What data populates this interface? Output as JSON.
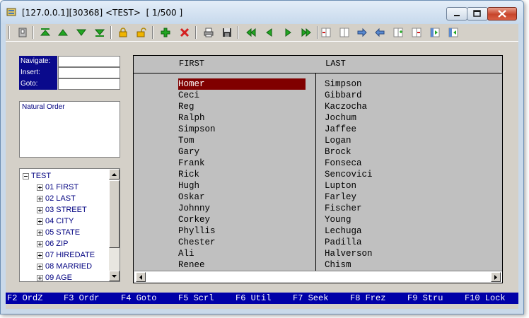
{
  "window": {
    "title": "[127.0.0.1][30368] <TEST>  [ 1/500 ]"
  },
  "toolbar": {
    "buttons": [
      {
        "icon": "disk-drive-icon"
      },
      {
        "icon": "go-top-icon"
      },
      {
        "icon": "go-up-icon"
      },
      {
        "icon": "go-down-icon"
      },
      {
        "icon": "go-bottom-icon"
      },
      {
        "icon": "lock-icon"
      },
      {
        "icon": "unlock-icon"
      },
      {
        "icon": "add-icon"
      },
      {
        "icon": "delete-icon"
      },
      {
        "icon": "print-icon"
      },
      {
        "icon": "save-icon"
      },
      {
        "icon": "first-record-icon"
      },
      {
        "icon": "prev-record-icon"
      },
      {
        "icon": "next-record-icon"
      },
      {
        "icon": "last-record-icon"
      },
      {
        "icon": "delete-column-icon"
      },
      {
        "icon": "column-icon"
      },
      {
        "icon": "move-right-icon"
      },
      {
        "icon": "move-left-icon"
      },
      {
        "icon": "insert-column-icon"
      },
      {
        "icon": "remove-column-icon"
      },
      {
        "icon": "freeze-left-icon"
      },
      {
        "icon": "freeze-right-icon"
      }
    ]
  },
  "nav": {
    "navigate_label": "Navigate:",
    "insert_label": "Insert:",
    "goto_label": "Goto:"
  },
  "order": {
    "text": "Natural Order"
  },
  "tree": {
    "root": "TEST",
    "items": [
      "01 FIRST",
      "02 LAST",
      "03 STREET",
      "04 CITY",
      "05 STATE",
      "06 ZIP",
      "07 HIREDATE",
      "08 MARRIED",
      "09 AGE"
    ]
  },
  "grid": {
    "columns": [
      "FIRST",
      "LAST"
    ],
    "rows": [
      [
        "Homer",
        "Simpson"
      ],
      [
        "Ceci",
        "Gibbard"
      ],
      [
        "Reg",
        "Kaczocha"
      ],
      [
        "Ralph",
        "Jochum"
      ],
      [
        "Simpson",
        "Jaffee"
      ],
      [
        "Tom",
        "Logan"
      ],
      [
        "Gary",
        "Brock"
      ],
      [
        "Frank",
        "Fonseca"
      ],
      [
        "Rick",
        "Sencovici"
      ],
      [
        "Hugh",
        "Lupton"
      ],
      [
        "Oskar",
        "Farley"
      ],
      [
        "Johnny",
        "Fischer"
      ],
      [
        "Corkey",
        "Young"
      ],
      [
        "Phyllis",
        "Lechuga"
      ],
      [
        "Chester",
        "Padilla"
      ],
      [
        "Ali",
        "Halverson"
      ],
      [
        "Renee",
        "Chism"
      ]
    ],
    "selected_row": 0
  },
  "fkeys": [
    "F2 OrdZ",
    "F3 Ordr",
    "F4 Goto",
    "F5 Scrl",
    "F6 Util",
    "F7 Seek",
    "F8 Frez",
    "F9 Stru",
    "F10 Lock"
  ],
  "colors": {
    "selection": "#800000",
    "label_bg": "#0a0a8c",
    "fkey_bg": "#0000a8",
    "tree_text": "#000080"
  }
}
